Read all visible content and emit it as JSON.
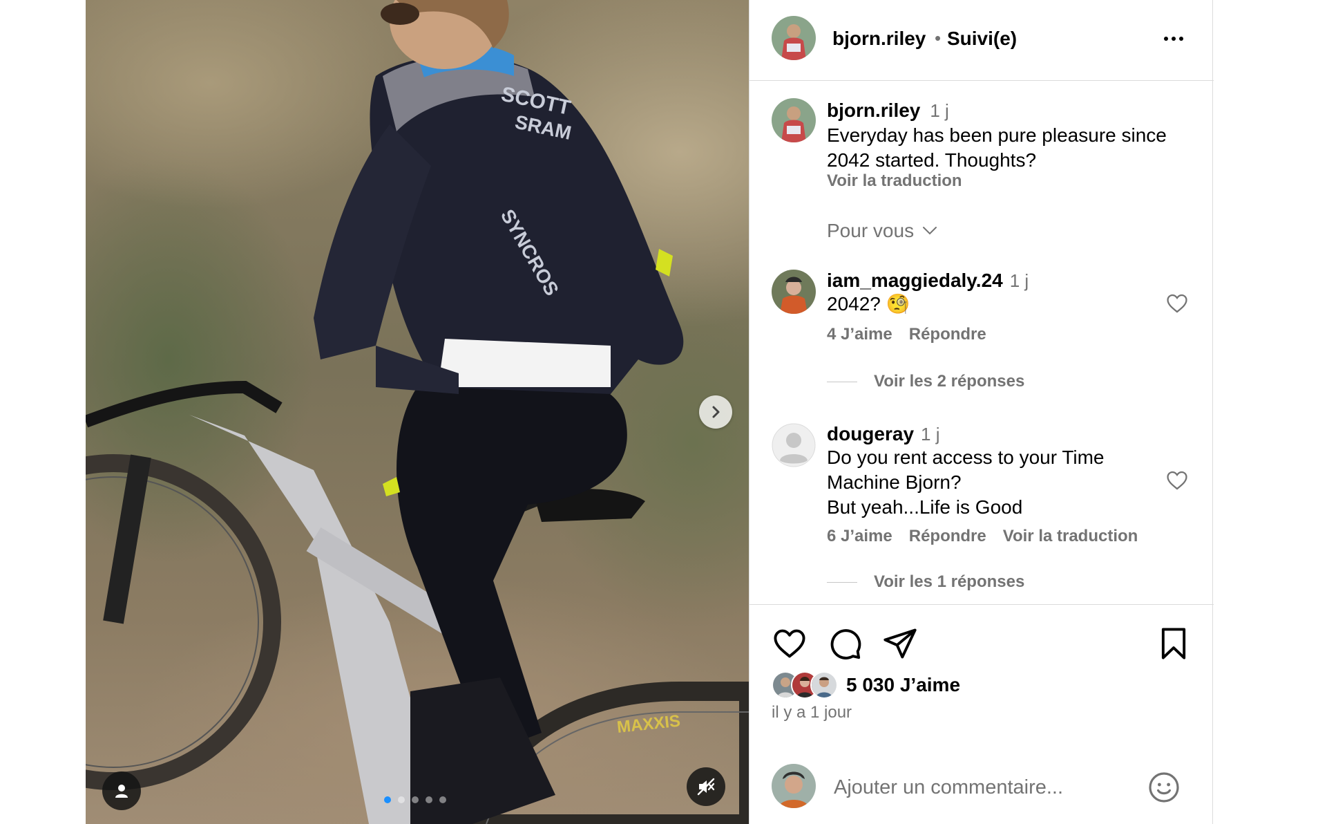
{
  "post": {
    "author": "bjorn.riley",
    "separator": "•",
    "follow_status": "Suivi(e)",
    "caption": {
      "username": "bjorn.riley",
      "time": "1 j",
      "text": "Everyday has been pure pleasure since 2042 started. Thoughts?",
      "translate": "Voir la traduction"
    },
    "filter_label": "Pour vous",
    "comments": [
      {
        "username": "iam_maggiedaly.24",
        "time": "1 j",
        "text": "2042?",
        "emoji": "🧐",
        "likes": "4 J’aime",
        "reply": "Répondre",
        "view_replies": "Voir les 2 réponses"
      },
      {
        "username": "dougeray",
        "time": "1 j",
        "text_lines": [
          "Do you rent access to your Time",
          "Machine Bjorn?",
          "But yeah...Life is Good"
        ],
        "likes": "6 J’aime",
        "reply": "Répondre",
        "translate": "Voir la traduction",
        "view_replies": "Voir les 1 réponses"
      }
    ],
    "likes_count": "5 030 J’aime",
    "posted_ago": "il y a 1 jour",
    "comment_placeholder": "Ajouter un commentaire...",
    "carousel": {
      "slides": 5,
      "active": 1
    }
  },
  "icons": {
    "more": "more-icon",
    "like": "heart-icon",
    "comment": "comment-icon",
    "share": "send-icon",
    "save": "bookmark-icon",
    "next": "chevron-right-icon",
    "tag": "user-tag-icon",
    "mute": "speaker-muted-icon",
    "emoji": "emoji-icon"
  },
  "colors": {
    "text": "#000000",
    "muted": "#737373",
    "border": "#dbdbdb",
    "accent": "#1a8fff",
    "jersey": "#1f2130",
    "jersey_collar": "#3b8fd4",
    "highlight": "#d4e021"
  }
}
